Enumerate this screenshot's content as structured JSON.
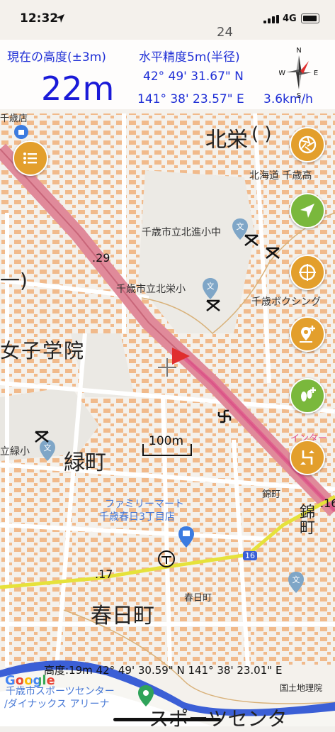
{
  "status_bar": {
    "time": "12:32",
    "network": "4G"
  },
  "hud": {
    "altitude_label": "現在の高度(±3m)",
    "accuracy_label": "水平精度5m(半径)",
    "altitude_value": "22m",
    "latitude": "42° 49' 31.67\" N",
    "longitude": "141° 38' 23.57\" E",
    "speed": "3.6km/h"
  },
  "map_labels": {
    "district_hokuei": "北栄",
    "district_hokuei_suffix": "(  )",
    "district_midori": "緑町",
    "district_kasuga": "春日町",
    "school_girls": "女子学院",
    "paren": "一)",
    "hokkaido_high": "北海道 千歳高",
    "hokushin_elem": "千歳市立北進小中",
    "hokuei_elem": "千歳市立北栄小",
    "boxing": "千歳ボクシング",
    "midori_elem": "立緑小",
    "family_mart_1": "ファミリーマート",
    "family_mart_2": "千歳春日3丁目店",
    "kasugacho_small": "春日町",
    "nishikicho_small": "錦町",
    "nishikicho_large": "錦町",
    "sports_center_1": "千歳市スポーツセンター",
    "sports_center_2": "/ダイナックス アリーナ",
    "sports_center_large": "スポーツセンタ",
    "elev_29": ".29",
    "elev_17": ".17",
    "elev_16": ".16",
    "road_16": "16",
    "intern": "インターナシ",
    "station_text": "千歳店",
    "top_label": "24"
  },
  "scale": {
    "label": "100m"
  },
  "bottom_info": "高度:19m  42° 49' 30.59\" N 141° 38' 23.01\" E",
  "attribution": {
    "google": "Google",
    "gsi": "国土地理院"
  },
  "colors": {
    "accent_blue": "#1f2fd6",
    "fab_orange": "#e39f2c",
    "fab_green": "#7ab83c",
    "road_pink": "#e08a9a",
    "building_orange": "#f0b07a",
    "river_blue": "#3b5fd6",
    "route_yellow": "#e6e23a"
  },
  "buttons": [
    {
      "name": "menu-button",
      "icon": "list-icon"
    },
    {
      "name": "map-layer-button",
      "icon": "aperture-icon"
    },
    {
      "name": "navigate-button",
      "icon": "navigation-arrow-icon"
    },
    {
      "name": "crosshair-button",
      "icon": "crosshair-icon"
    },
    {
      "name": "add-location-button",
      "icon": "add-pin-icon"
    },
    {
      "name": "add-footprint-button",
      "icon": "footprint-icon"
    },
    {
      "name": "route-button",
      "icon": "route-icon"
    }
  ]
}
